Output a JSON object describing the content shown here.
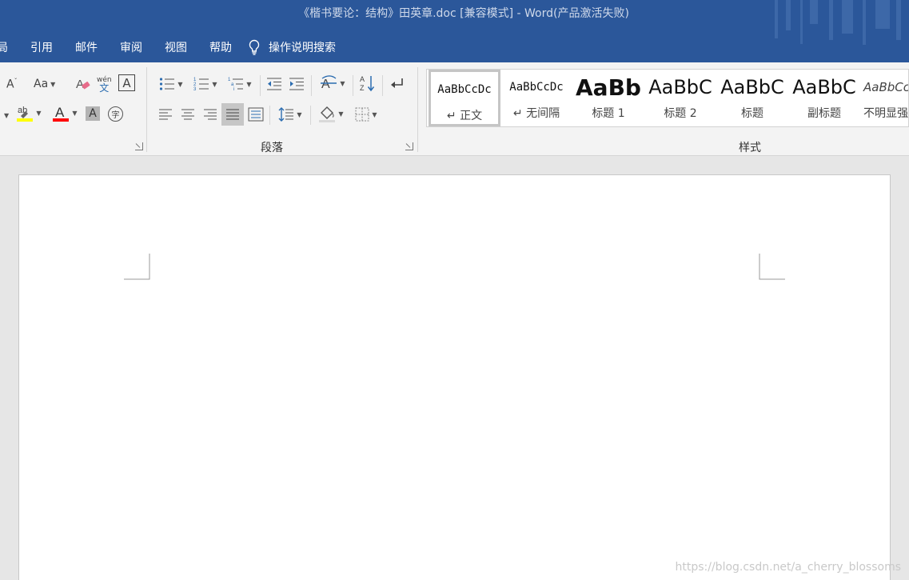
{
  "window": {
    "title": "《楷书要论：结构》田英章.doc [兼容模式] - Word(产品激活失败)"
  },
  "tabs": [
    {
      "label": "局"
    },
    {
      "label": "引用"
    },
    {
      "label": "邮件"
    },
    {
      "label": "审阅"
    },
    {
      "label": "视图"
    },
    {
      "label": "帮助"
    }
  ],
  "tell_me": {
    "label": "操作说明搜索"
  },
  "ribbon": {
    "font_icons": {
      "change_case": "Aa",
      "phonetic_top": "wén",
      "phonetic_bottom": "文",
      "char_border": "A",
      "shading": "A",
      "enclose": "字"
    },
    "paragraph_label": "段落",
    "styles_label": "样式"
  },
  "styles": [
    {
      "sample": "AaBbCcDc",
      "name": "↵ 正文",
      "selected": true
    },
    {
      "sample": "AaBbCcDc",
      "name": "↵ 无间隔"
    },
    {
      "sample": "AaBb",
      "name": "标题 1"
    },
    {
      "sample": "AaBbC",
      "name": "标题 2"
    },
    {
      "sample": "AaBbC",
      "name": "标题"
    },
    {
      "sample": "AaBbC",
      "name": "副标题"
    },
    {
      "sample": "AaBbCcD",
      "name": "不明显强"
    }
  ],
  "watermark": "https://blog.csdn.net/a_cherry_blossoms",
  "colors": {
    "titlebar": "#2b579a",
    "highlight": "#ffff00",
    "font_color": "#ff0000"
  }
}
